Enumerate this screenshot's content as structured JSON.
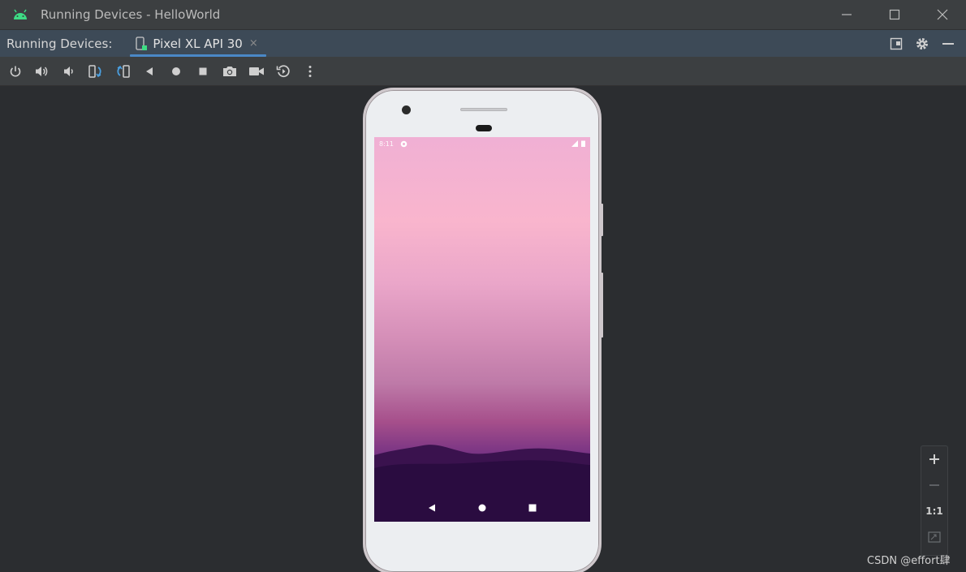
{
  "window": {
    "title": "Running Devices - HelloWorld",
    "app_icon": "android-icon",
    "controls": [
      "minimize-icon",
      "maximize-icon",
      "close-icon"
    ]
  },
  "tool_window": {
    "title": "Running Devices:",
    "tab": {
      "label": "Pixel XL API 30",
      "close": "×",
      "icon": "device-icon",
      "active": true
    },
    "right_icons": [
      "float-window-icon",
      "gear-icon",
      "hide-icon"
    ]
  },
  "toolbar": {
    "buttons": [
      "power-icon",
      "volume-up-icon",
      "volume-down-icon",
      "rotate-left-icon",
      "rotate-right-icon",
      "back-icon",
      "home-icon",
      "overview-icon",
      "screenshot-icon",
      "screen-record-icon",
      "snapshot-icon",
      "more-icon"
    ]
  },
  "device": {
    "status_time": "8:11",
    "nav": [
      "nav-back-icon",
      "nav-home-icon",
      "nav-recents-icon"
    ]
  },
  "zoom": {
    "plus": "+",
    "minus": "−",
    "actual": "1:1",
    "fit_icon": "fit-screen-icon"
  },
  "watermark": "CSDN @effort肆",
  "colors": {
    "accent": "#4a88c7",
    "android_green": "#3ddc84",
    "titlebar": "#3c3f41",
    "tabbar": "#3d4a57"
  }
}
